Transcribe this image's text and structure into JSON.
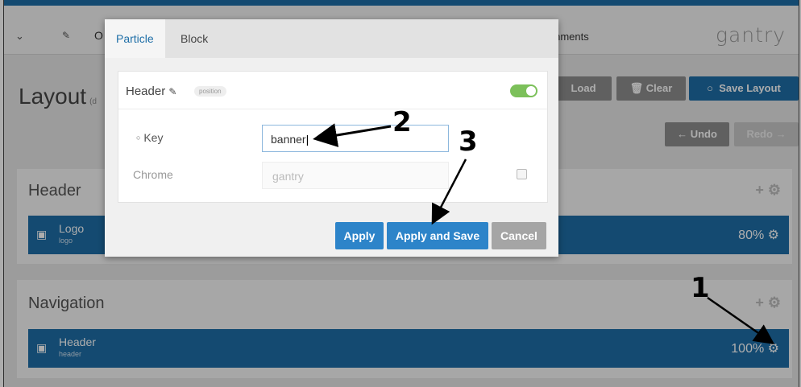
{
  "navbar": {
    "partial_label": "O",
    "assignments_label": "ssignments",
    "brand": "gantry"
  },
  "page": {
    "title": "Layout",
    "title_suffix": "(d"
  },
  "toolbar": {
    "load_label": "Load",
    "clear_label": "Clear",
    "save_layout_label": "Save Layout",
    "undo_label": "Undo",
    "redo_label": "Redo"
  },
  "sections": [
    {
      "title": "Header",
      "bar": {
        "name": "Logo",
        "sub": "logo",
        "percent": "80%"
      }
    },
    {
      "title": "Navigation",
      "bar": {
        "name": "Header",
        "sub": "header",
        "percent": "100%"
      }
    }
  ],
  "modal": {
    "tabs": [
      "Particle",
      "Block"
    ],
    "active_tab": "Particle",
    "particle_title": "Header",
    "particle_badge": "position",
    "enabled": true,
    "fields": {
      "key_label": "Key",
      "key_value": "banner",
      "chrome_label": "Chrome",
      "chrome_placeholder": "gantry"
    },
    "buttons": {
      "apply": "Apply",
      "apply_and_save": "Apply and Save",
      "cancel": "Cancel"
    }
  },
  "annotations": [
    "1",
    "2",
    "3"
  ],
  "colors": {
    "primary": "#1e6ea7",
    "apply_button": "#2d84c9",
    "toggle_on": "#7cc05a",
    "cancel_button": "#a5a5a5"
  }
}
